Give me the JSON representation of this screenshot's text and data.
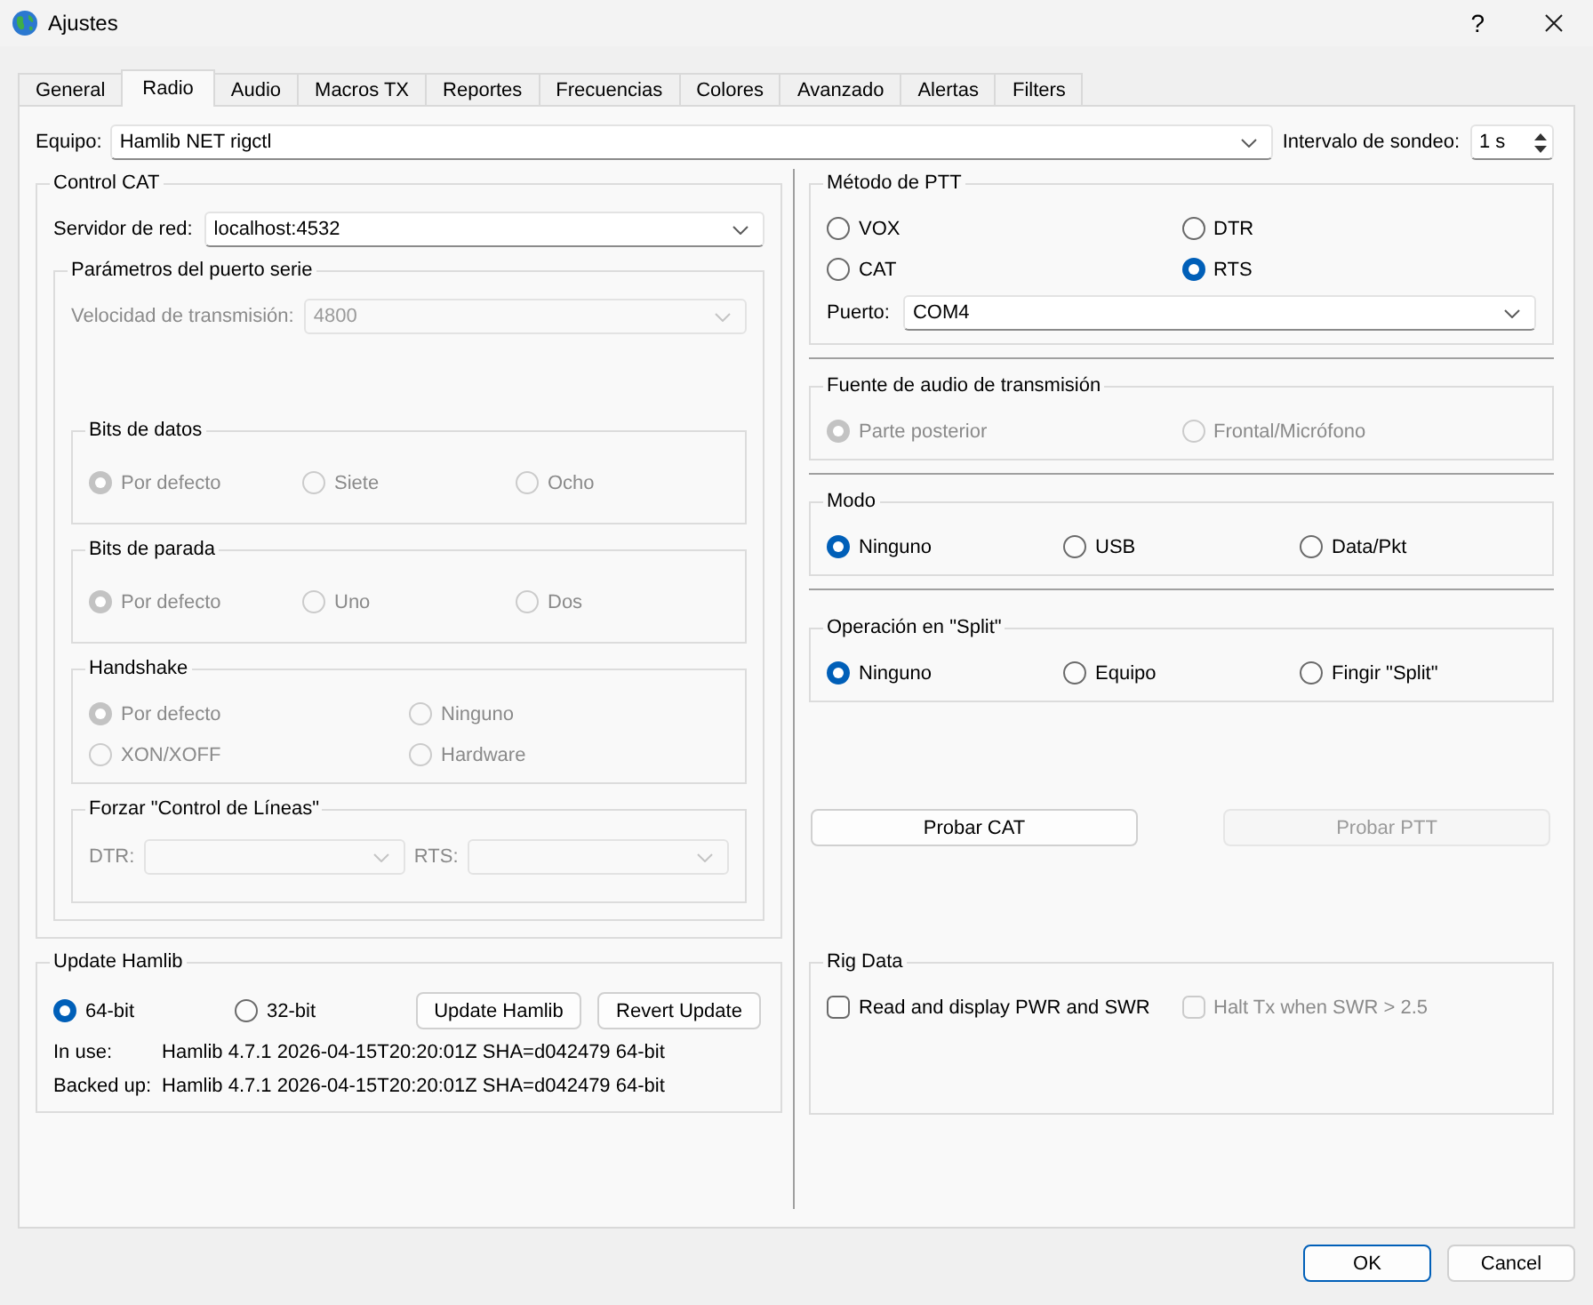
{
  "window": {
    "title": "Ajustes",
    "help": "?"
  },
  "tabs": [
    {
      "label": "General",
      "selected": false
    },
    {
      "label": "Radio",
      "selected": true
    },
    {
      "label": "Audio",
      "selected": false
    },
    {
      "label": "Macros TX",
      "selected": false
    },
    {
      "label": "Reportes",
      "selected": false
    },
    {
      "label": "Frecuencias",
      "selected": false
    },
    {
      "label": "Colores",
      "selected": false
    },
    {
      "label": "Avanzado",
      "selected": false
    },
    {
      "label": "Alertas",
      "selected": false
    },
    {
      "label": "Filters",
      "selected": false
    }
  ],
  "rig": {
    "label": "Equipo:",
    "value": "Hamlib NET rigctl",
    "disabled": false
  },
  "poll_interval": {
    "label": "Intervalo de sondeo:",
    "value": "1 s"
  },
  "cat_control": {
    "title": "Control CAT",
    "server": {
      "label": "Servidor de red:",
      "value": "localhost:4532",
      "disabled": false
    },
    "serial_port": {
      "title": "Parámetros del puerto serie",
      "baud_rate": {
        "label": "Velocidad de transmisión:",
        "value": "4800",
        "disabled": true
      },
      "groups": [
        {
          "title": "Bits de datos",
          "disabled": true,
          "options": [
            {
              "label": "Por defecto",
              "selected": true
            },
            {
              "label": "Siete",
              "selected": false
            },
            {
              "label": "Ocho",
              "selected": false
            }
          ]
        },
        {
          "title": "Bits de parada",
          "disabled": true,
          "options": [
            {
              "label": "Por defecto",
              "selected": true
            },
            {
              "label": "Uno",
              "selected": false
            },
            {
              "label": "Dos",
              "selected": false
            }
          ]
        },
        {
          "title": "Handshake",
          "disabled": true,
          "options": [
            {
              "label": "Por defecto",
              "selected": true
            },
            {
              "label": "Ninguno",
              "selected": false
            },
            {
              "label": "XON/XOFF",
              "selected": false
            },
            {
              "label": "Hardware",
              "selected": false
            }
          ]
        }
      ],
      "line_control": {
        "title": "Forzar \"Control de Líneas\"",
        "fields": [
          {
            "label": "DTR:",
            "disabled": true
          },
          {
            "label": "RTS:",
            "disabled": true
          }
        ]
      }
    }
  },
  "update_hamlib": {
    "title": "Update Hamlib",
    "options": [
      {
        "label": "64-bit",
        "selected": true
      },
      {
        "label": "32-bit",
        "selected": false
      }
    ],
    "buttons": [
      {
        "label": "Update Hamlib"
      },
      {
        "label": "Revert Update"
      }
    ],
    "info": [
      {
        "label": "In use:",
        "value": "Hamlib 4.7.1 2026-04-15T20:20:01Z SHA=d042479 64-bit"
      },
      {
        "label": "Backed up:",
        "value": "Hamlib 4.7.1 2026-04-15T20:20:01Z SHA=d042479 64-bit"
      }
    ]
  },
  "ptt_method": {
    "title": "Método de PTT",
    "disabled": false,
    "options": [
      {
        "label": "VOX",
        "selected": false
      },
      {
        "label": "DTR",
        "selected": false
      },
      {
        "label": "CAT",
        "selected": false
      },
      {
        "label": "RTS",
        "selected": true
      }
    ],
    "port": {
      "label": "Puerto:",
      "value": "COM4",
      "disabled": false
    }
  },
  "tx_audio_source": {
    "title": "Fuente de audio de transmisión",
    "disabled": true,
    "options": [
      {
        "label": "Parte posterior",
        "selected": true
      },
      {
        "label": "Frontal/Micrófono",
        "selected": false
      }
    ]
  },
  "mode": {
    "title": "Modo",
    "disabled": false,
    "options": [
      {
        "label": "Ninguno",
        "selected": true
      },
      {
        "label": "USB",
        "selected": false
      },
      {
        "label": "Data/Pkt",
        "selected": false
      }
    ]
  },
  "split_operation": {
    "title": "Operación en \"Split\"",
    "disabled": false,
    "options": [
      {
        "label": "Ninguno",
        "selected": true
      },
      {
        "label": "Equipo",
        "selected": false
      },
      {
        "label": "Fingir \"Split\"",
        "selected": false
      }
    ]
  },
  "test_buttons": [
    {
      "label": "Probar CAT",
      "disabled": false
    },
    {
      "label": "Probar PTT",
      "disabled": true
    }
  ],
  "rig_data": {
    "title": "Rig Data",
    "checks": [
      {
        "label": "Read and display PWR and SWR",
        "checked": false,
        "disabled": false
      },
      {
        "label": "Halt Tx when SWR > 2.5",
        "checked": false,
        "disabled": true
      }
    ]
  },
  "dialog_buttons": [
    {
      "label": "OK",
      "default": true
    },
    {
      "label": "Cancel",
      "default": false
    }
  ]
}
